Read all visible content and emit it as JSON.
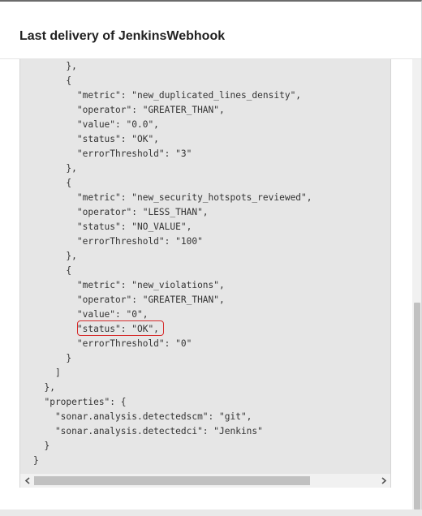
{
  "dialog": {
    "title": "Last delivery of JenkinsWebhook"
  },
  "payload": {
    "lines": [
      "      },",
      "      {",
      "        \"metric\": \"new_duplicated_lines_density\",",
      "        \"operator\": \"GREATER_THAN\",",
      "        \"value\": \"0.0\",",
      "        \"status\": \"OK\",",
      "        \"errorThreshold\": \"3\"",
      "      },",
      "      {",
      "        \"metric\": \"new_security_hotspots_reviewed\",",
      "        \"operator\": \"LESS_THAN\",",
      "        \"status\": \"NO_VALUE\",",
      "        \"errorThreshold\": \"100\"",
      "      },",
      "      {",
      "        \"metric\": \"new_violations\",",
      "        \"operator\": \"GREATER_THAN\",",
      "        \"value\": \"0\",",
      "        \"status\": \"OK\",",
      "        \"errorThreshold\": \"0\"",
      "      }",
      "    ]",
      "  },",
      "  \"properties\": {",
      "    \"sonar.analysis.detectedscm\": \"git\",",
      "    \"sonar.analysis.detectedci\": \"Jenkins\"",
      "  }",
      "}"
    ]
  },
  "annotation": {
    "color": "#d62b2b"
  },
  "icons": {
    "scroll_left": "scroll-left-arrow-icon",
    "scroll_right": "scroll-right-arrow-icon"
  }
}
